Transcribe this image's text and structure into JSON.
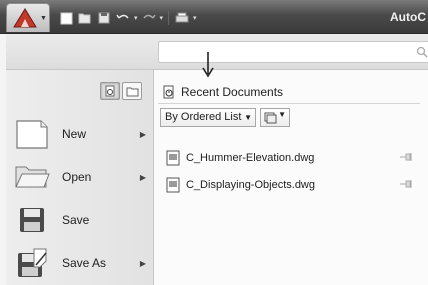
{
  "titlebar": {
    "title": "AutoC",
    "quick_access": [
      "new-icon",
      "open-icon",
      "save-icon",
      "undo-icon",
      "redo-icon",
      "plot-icon"
    ]
  },
  "search": {
    "placeholder": ""
  },
  "left_menu": {
    "items": [
      {
        "label": "New",
        "has_submenu": true,
        "icon": "new-document-icon"
      },
      {
        "label": "Open",
        "has_submenu": true,
        "icon": "open-folder-icon"
      },
      {
        "label": "Save",
        "has_submenu": false,
        "icon": "save-floppy-icon"
      },
      {
        "label": "Save As",
        "has_submenu": true,
        "icon": "save-as-icon"
      }
    ]
  },
  "recent": {
    "header": "Recent Documents",
    "order_by": "By Ordered List",
    "files": [
      {
        "name": "C_Hummer-Elevation.dwg"
      },
      {
        "name": "C_Displaying-Objects.dwg"
      }
    ]
  },
  "colors": {
    "titlebar": "#4a4a4a",
    "pane": "#e6e6e6",
    "content": "#fbfbfb"
  }
}
